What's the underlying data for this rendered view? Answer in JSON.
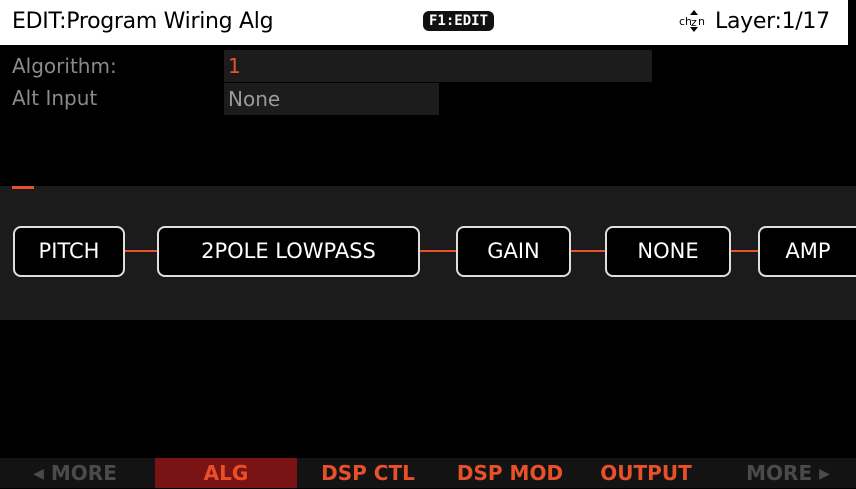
{
  "titlebar": {
    "title": "EDIT:Program Wiring Alg",
    "f1_label": "F1:EDIT",
    "chain_icon": "chain-updown-icon",
    "layer": "Layer:1/17"
  },
  "params": {
    "algorithm": {
      "label": "Algorithm:",
      "value": "1"
    },
    "alt_input": {
      "label": "Alt Input",
      "value": "None"
    }
  },
  "wiring": {
    "blocks": [
      "PITCH",
      "2POLE LOWPASS",
      "GAIN",
      "NONE",
      "AMP"
    ]
  },
  "softbuttons": {
    "more_left": "MORE",
    "alg": "ALG",
    "dsp_ctl": "DSP CTL",
    "dsp_mod": "DSP MOD",
    "output": "OUTPUT",
    "more_right": "MORE"
  },
  "colors": {
    "accent": "#e8502a",
    "active_tab": "#7a1414",
    "titlebar_bg": "#ffffff"
  }
}
